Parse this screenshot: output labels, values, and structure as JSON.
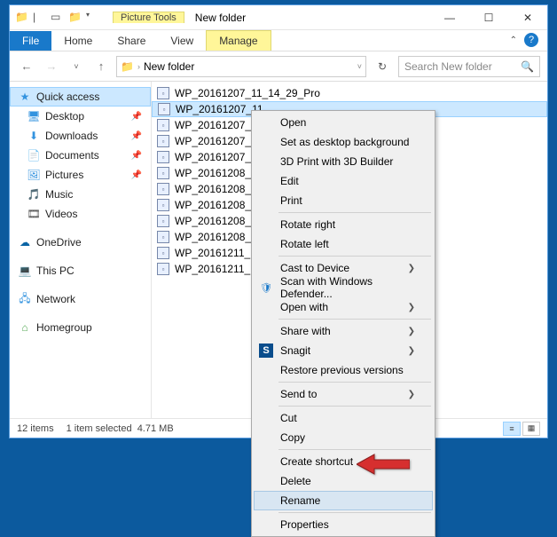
{
  "window": {
    "picture_tools": "Picture Tools",
    "title": "New folder"
  },
  "tabs": {
    "file": "File",
    "home": "Home",
    "share": "Share",
    "view": "View",
    "manage": "Manage"
  },
  "nav": {
    "path": "New folder",
    "search_placeholder": "Search New folder"
  },
  "sidebar": {
    "quick_access": "Quick access",
    "items": [
      {
        "label": "Desktop"
      },
      {
        "label": "Downloads"
      },
      {
        "label": "Documents"
      },
      {
        "label": "Pictures"
      },
      {
        "label": "Music"
      },
      {
        "label": "Videos"
      }
    ],
    "onedrive": "OneDrive",
    "thispc": "This PC",
    "network": "Network",
    "homegroup": "Homegroup"
  },
  "files": [
    "WP_20161207_11_14_29_Pro",
    "WP_20161207_11_",
    "WP_20161207_11_",
    "WP_20161207_11_",
    "WP_20161207_11_",
    "WP_20161208_21_",
    "WP_20161208_21_",
    "WP_20161208_21_",
    "WP_20161208_21_",
    "WP_20161208_21_",
    "WP_20161211_14_",
    "WP_20161211_14_"
  ],
  "status": {
    "count": "12 items",
    "selected": "1 item selected",
    "size": "4.71 MB"
  },
  "context_menu": [
    {
      "type": "item",
      "label": "Open"
    },
    {
      "type": "item",
      "label": "Set as desktop background"
    },
    {
      "type": "item",
      "label": "3D Print with 3D Builder"
    },
    {
      "type": "item",
      "label": "Edit"
    },
    {
      "type": "item",
      "label": "Print"
    },
    {
      "type": "sep"
    },
    {
      "type": "item",
      "label": "Rotate right"
    },
    {
      "type": "item",
      "label": "Rotate left"
    },
    {
      "type": "sep"
    },
    {
      "type": "item",
      "label": "Cast to Device",
      "arrow": true
    },
    {
      "type": "item",
      "label": "Scan with Windows Defender...",
      "icon": "shield"
    },
    {
      "type": "item",
      "label": "Open with",
      "arrow": true
    },
    {
      "type": "sep"
    },
    {
      "type": "item",
      "label": "Share with",
      "arrow": true
    },
    {
      "type": "item",
      "label": "Snagit",
      "arrow": true,
      "icon": "snagit"
    },
    {
      "type": "item",
      "label": "Restore previous versions"
    },
    {
      "type": "sep"
    },
    {
      "type": "item",
      "label": "Send to",
      "arrow": true
    },
    {
      "type": "sep"
    },
    {
      "type": "item",
      "label": "Cut"
    },
    {
      "type": "item",
      "label": "Copy"
    },
    {
      "type": "sep"
    },
    {
      "type": "item",
      "label": "Create shortcut"
    },
    {
      "type": "item",
      "label": "Delete"
    },
    {
      "type": "item",
      "label": "Rename",
      "hover": true
    },
    {
      "type": "sep"
    },
    {
      "type": "item",
      "label": "Properties"
    }
  ]
}
